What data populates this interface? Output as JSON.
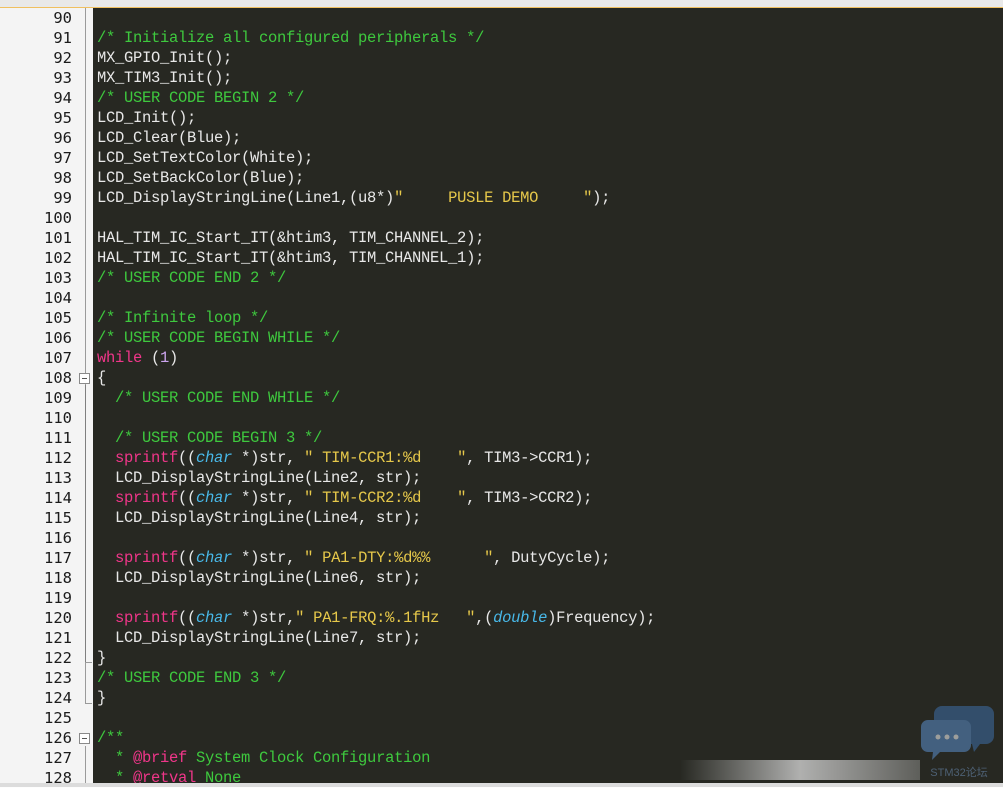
{
  "editor": {
    "lines": [
      {
        "num": "90",
        "tokens": []
      },
      {
        "num": "91",
        "tokens": [
          {
            "c": "c",
            "t": "/* Initialize all configured peripherals */"
          }
        ]
      },
      {
        "num": "92",
        "tokens": [
          {
            "c": "p",
            "t": "MX_GPIO_Init();"
          }
        ]
      },
      {
        "num": "93",
        "tokens": [
          {
            "c": "p",
            "t": "MX_TIM3_Init();"
          }
        ]
      },
      {
        "num": "94",
        "tokens": [
          {
            "c": "c",
            "t": "/* USER CODE BEGIN 2 */"
          }
        ]
      },
      {
        "num": "95",
        "tokens": [
          {
            "c": "p",
            "t": "LCD_Init();"
          }
        ]
      },
      {
        "num": "96",
        "tokens": [
          {
            "c": "p",
            "t": "LCD_Clear(Blue);"
          }
        ]
      },
      {
        "num": "97",
        "tokens": [
          {
            "c": "p",
            "t": "LCD_SetTextColor(White);"
          }
        ]
      },
      {
        "num": "98",
        "tokens": [
          {
            "c": "p",
            "t": "LCD_SetBackColor(Blue);"
          }
        ]
      },
      {
        "num": "99",
        "tokens": [
          {
            "c": "p",
            "t": "LCD_DisplayStringLine(Line1,(u8*)"
          },
          {
            "c": "s",
            "t": "\"     PUSLE DEMO     \""
          },
          {
            "c": "p",
            "t": ");"
          }
        ]
      },
      {
        "num": "100",
        "tokens": []
      },
      {
        "num": "101",
        "tokens": [
          {
            "c": "p",
            "t": "HAL_TIM_IC_Start_IT(&htim3, TIM_CHANNEL_2);"
          }
        ]
      },
      {
        "num": "102",
        "tokens": [
          {
            "c": "p",
            "t": "HAL_TIM_IC_Start_IT(&htim3, TIM_CHANNEL_1);"
          }
        ]
      },
      {
        "num": "103",
        "tokens": [
          {
            "c": "c",
            "t": "/* USER CODE END 2 */"
          }
        ]
      },
      {
        "num": "104",
        "tokens": []
      },
      {
        "num": "105",
        "tokens": [
          {
            "c": "c",
            "t": "/* Infinite loop */"
          }
        ]
      },
      {
        "num": "106",
        "tokens": [
          {
            "c": "c",
            "t": "/* USER CODE BEGIN WHILE */"
          }
        ]
      },
      {
        "num": "107",
        "tokens": [
          {
            "c": "k",
            "t": "while"
          },
          {
            "c": "p",
            "t": " ("
          },
          {
            "c": "n",
            "t": "1"
          },
          {
            "c": "p",
            "t": ")"
          }
        ]
      },
      {
        "num": "108",
        "tokens": [
          {
            "c": "p",
            "t": "{"
          }
        ]
      },
      {
        "num": "109",
        "tokens": [
          {
            "c": "p",
            "t": "  "
          },
          {
            "c": "c",
            "t": "/* USER CODE END WHILE */"
          }
        ]
      },
      {
        "num": "110",
        "tokens": []
      },
      {
        "num": "111",
        "tokens": [
          {
            "c": "p",
            "t": "  "
          },
          {
            "c": "c",
            "t": "/* USER CODE BEGIN 3 */"
          }
        ]
      },
      {
        "num": "112",
        "tokens": [
          {
            "c": "p",
            "t": "  "
          },
          {
            "c": "k",
            "t": "sprintf"
          },
          {
            "c": "p",
            "t": "(("
          },
          {
            "c": "t",
            "t": "char"
          },
          {
            "c": "p",
            "t": " *)str, "
          },
          {
            "c": "s",
            "t": "\" TIM-CCR1:%d    \""
          },
          {
            "c": "p",
            "t": ", TIM3->CCR1);"
          }
        ]
      },
      {
        "num": "113",
        "tokens": [
          {
            "c": "p",
            "t": "  LCD_DisplayStringLine(Line2, str);"
          }
        ]
      },
      {
        "num": "114",
        "tokens": [
          {
            "c": "p",
            "t": "  "
          },
          {
            "c": "k",
            "t": "sprintf"
          },
          {
            "c": "p",
            "t": "(("
          },
          {
            "c": "t",
            "t": "char"
          },
          {
            "c": "p",
            "t": " *)str, "
          },
          {
            "c": "s",
            "t": "\" TIM-CCR2:%d    \""
          },
          {
            "c": "p",
            "t": ", TIM3->CCR2);"
          }
        ]
      },
      {
        "num": "115",
        "tokens": [
          {
            "c": "p",
            "t": "  LCD_DisplayStringLine(Line4, str);"
          }
        ]
      },
      {
        "num": "116",
        "tokens": []
      },
      {
        "num": "117",
        "tokens": [
          {
            "c": "p",
            "t": "  "
          },
          {
            "c": "k",
            "t": "sprintf"
          },
          {
            "c": "p",
            "t": "(("
          },
          {
            "c": "t",
            "t": "char"
          },
          {
            "c": "p",
            "t": " *)str, "
          },
          {
            "c": "s",
            "t": "\" PA1-DTY:%d%%      \""
          },
          {
            "c": "p",
            "t": ", DutyCycle);"
          }
        ]
      },
      {
        "num": "118",
        "tokens": [
          {
            "c": "p",
            "t": "  LCD_DisplayStringLine(Line6, str);"
          }
        ]
      },
      {
        "num": "119",
        "tokens": []
      },
      {
        "num": "120",
        "tokens": [
          {
            "c": "p",
            "t": "  "
          },
          {
            "c": "k",
            "t": "sprintf"
          },
          {
            "c": "p",
            "t": "(("
          },
          {
            "c": "t",
            "t": "char"
          },
          {
            "c": "p",
            "t": " *)str,"
          },
          {
            "c": "s",
            "t": "\" PA1-FRQ:%.1fHz   \""
          },
          {
            "c": "p",
            "t": ",("
          },
          {
            "c": "t",
            "t": "double"
          },
          {
            "c": "p",
            "t": ")Frequency);"
          }
        ]
      },
      {
        "num": "121",
        "tokens": [
          {
            "c": "p",
            "t": "  LCD_DisplayStringLine(Line7, str);"
          }
        ]
      },
      {
        "num": "122",
        "tokens": [
          {
            "c": "p",
            "t": "}"
          }
        ]
      },
      {
        "num": "123",
        "tokens": [
          {
            "c": "c",
            "t": "/* USER CODE END 3 */"
          }
        ]
      },
      {
        "num": "124",
        "tokens": [
          {
            "c": "p",
            "t": "}"
          }
        ]
      },
      {
        "num": "125",
        "tokens": []
      },
      {
        "num": "126",
        "tokens": [
          {
            "c": "c",
            "t": "/**"
          }
        ]
      },
      {
        "num": "127",
        "tokens": [
          {
            "c": "c",
            "t": "  * "
          },
          {
            "c": "k",
            "t": "@brief"
          },
          {
            "c": "c",
            "t": " System Clock Configuration"
          }
        ]
      },
      {
        "num": "128",
        "tokens": [
          {
            "c": "c",
            "t": "  * "
          },
          {
            "c": "k",
            "t": "@retval"
          },
          {
            "c": "c",
            "t": " None"
          }
        ]
      }
    ]
  },
  "watermark": {
    "text": "STM32论坛"
  },
  "colors": {
    "editor_bg": "#272822",
    "comment": "#3ec93e",
    "string": "#e6c84a",
    "keyword": "#f0368a",
    "type": "#48b8e8",
    "number": "#cba4ee",
    "plain": "#e8e8e8"
  }
}
